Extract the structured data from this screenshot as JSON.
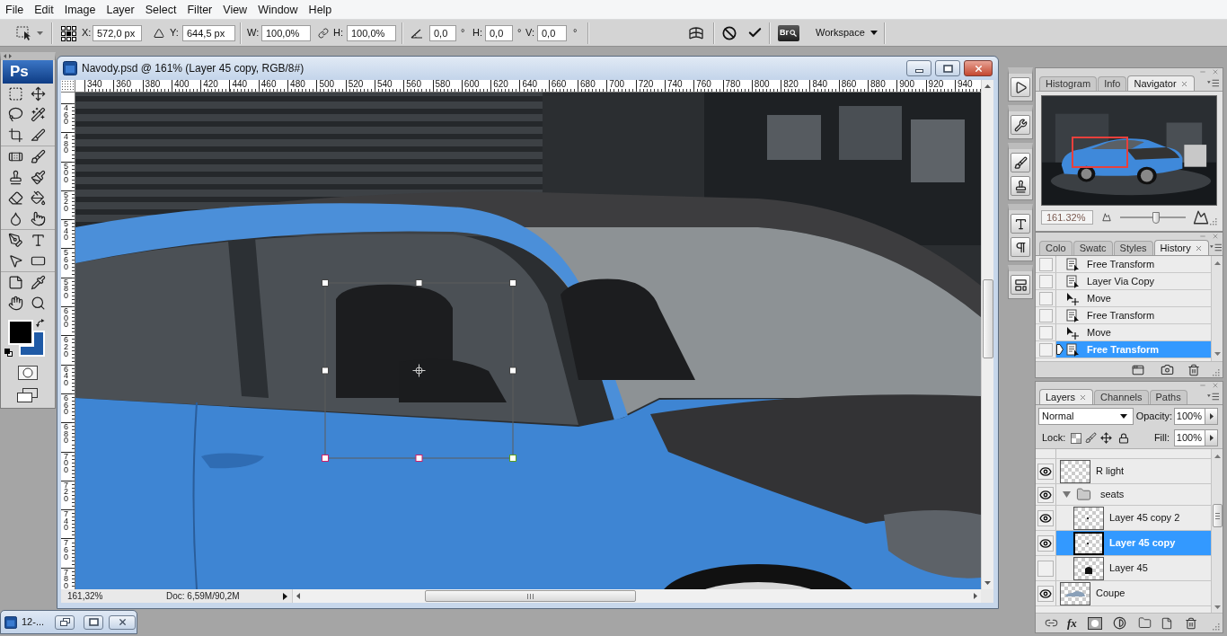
{
  "menu_bar": {
    "items": [
      "File",
      "Edit",
      "Image",
      "Layer",
      "Select",
      "Filter",
      "View",
      "Window",
      "Help"
    ]
  },
  "options_bar": {
    "fields": [
      {
        "label": "X:",
        "value": "572,0 px"
      },
      {
        "label": "Y:",
        "value": "644,5 px"
      },
      {
        "label": "W:",
        "value": "100,0%"
      },
      {
        "label": "H:",
        "value": "100,0%"
      },
      {
        "value": "0,0",
        "unit": "°"
      },
      {
        "label": "H:",
        "value": "0,0",
        "unit": "°"
      },
      {
        "label": "V:",
        "value": "0,0",
        "unit": "°"
      }
    ],
    "bridge_button": "Br",
    "workspace_button": "Workspace"
  },
  "tools_panel": {
    "logo": "Ps",
    "swatches": [
      {
        "kind": "foreground",
        "color": "#000000"
      },
      {
        "kind": "background",
        "color": "#1f5aa6"
      }
    ]
  },
  "document_window": {
    "title": "Navody.psd @ 161% (Layer 45 copy, RGB/8#)",
    "horizontal_ruler": [
      "340",
      "360",
      "380",
      "400",
      "420",
      "440",
      "460",
      "480",
      "500",
      "520",
      "540",
      "560",
      "580",
      "600",
      "620",
      "640",
      "660",
      "680",
      "700",
      "720",
      "740",
      "760",
      "780",
      "800",
      "820",
      "840",
      "860",
      "880",
      "900",
      "920",
      "940"
    ],
    "vertical_ruler": [
      "460",
      "480",
      "500",
      "520",
      "540",
      "560",
      "580",
      "600",
      "620",
      "640",
      "660",
      "680",
      "700",
      "720",
      "740",
      "760",
      "780"
    ],
    "status_zoom": "161,32%",
    "status_doc": "Doc: 6,59M/90,2M"
  },
  "minimized_window": {
    "title": "12-..."
  },
  "navigator_panel": {
    "tabs": [
      {
        "label": "Histogram",
        "selected": false
      },
      {
        "label": "Info",
        "selected": false
      },
      {
        "label": "Navigator",
        "selected": true
      }
    ],
    "zoom_field": "161.32%",
    "zoom_slider": {
      "level": 0.56
    }
  },
  "history_panel": {
    "tabs": [
      {
        "label": "Colo",
        "selected": false
      },
      {
        "label": "Swatc",
        "selected": false
      },
      {
        "label": "Styles",
        "selected": false
      },
      {
        "label": "History",
        "selected": true
      }
    ],
    "items": [
      {
        "label": "Free Transform",
        "kind": "command",
        "selected": false
      },
      {
        "label": "Layer Via Copy",
        "kind": "command",
        "selected": false
      },
      {
        "label": "Move",
        "kind": "move",
        "selected": false
      },
      {
        "label": "Free Transform",
        "kind": "command",
        "selected": false
      },
      {
        "label": "Move",
        "kind": "move",
        "selected": false
      },
      {
        "label": "Free Transform",
        "kind": "command",
        "selected": true
      }
    ]
  },
  "layers_panel": {
    "tabs": [
      {
        "label": "Layers",
        "selected": true
      },
      {
        "label": "Channels",
        "selected": false
      },
      {
        "label": "Paths",
        "selected": false
      }
    ],
    "blend_mode": "Normal",
    "opacity_label": "Opacity:",
    "opacity": "100%",
    "lock_label": "Lock:",
    "fill_label": "Fill:",
    "fill": "100%",
    "fx_button": "fx",
    "layers": [
      {
        "name": "R light",
        "kind": "layer",
        "thumbnail": {
          "kind": "blank"
        },
        "visible": true,
        "selected": false
      },
      {
        "name": "seats",
        "kind": "group",
        "visible": true,
        "selected": false,
        "expanded": true,
        "children": [
          {
            "name": "Layer 45 copy 2",
            "kind": "layer",
            "thumbnail": {
              "kind": "dot"
            },
            "visible": true,
            "selected": false
          },
          {
            "name": "Layer 45 copy",
            "kind": "layer",
            "thumbnail": {
              "kind": "dot"
            },
            "visible": true,
            "selected": true
          },
          {
            "name": "Layer 45",
            "kind": "layer",
            "thumbnail": {
              "kind": "seat"
            },
            "visible": false,
            "selected": false
          }
        ]
      },
      {
        "name": "Coupe",
        "kind": "layer",
        "thumbnail": {
          "kind": "car"
        },
        "visible": true,
        "selected": false
      }
    ]
  }
}
